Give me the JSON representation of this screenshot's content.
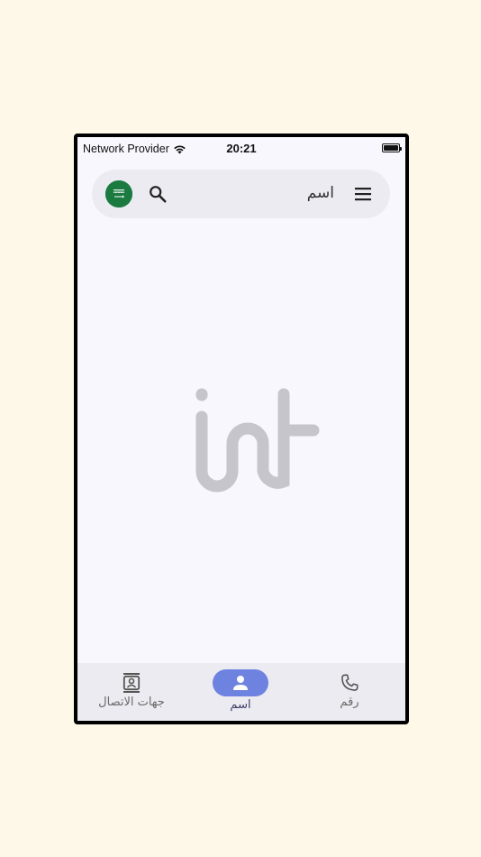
{
  "status_bar": {
    "carrier": "Network Provider",
    "time": "20:21"
  },
  "search_bar": {
    "name_label": "اسم",
    "flag": "saudi-arabia-flag",
    "icons": [
      "search-icon",
      "menu-icon"
    ]
  },
  "logo": "int-logo",
  "bottom_nav": {
    "items": [
      {
        "label": "جهات الاتصال",
        "icon": "contacts-icon",
        "active": false
      },
      {
        "label": "اسم",
        "icon": "person-icon",
        "active": true
      },
      {
        "label": "رقم",
        "icon": "phone-icon",
        "active": false
      }
    ]
  },
  "colors": {
    "background": "#fdf8e7",
    "screen": "#f8f7fd",
    "accent": "#6e82e0",
    "flag_green": "#1a7a40",
    "logo_gray": "#c6c5cc"
  }
}
